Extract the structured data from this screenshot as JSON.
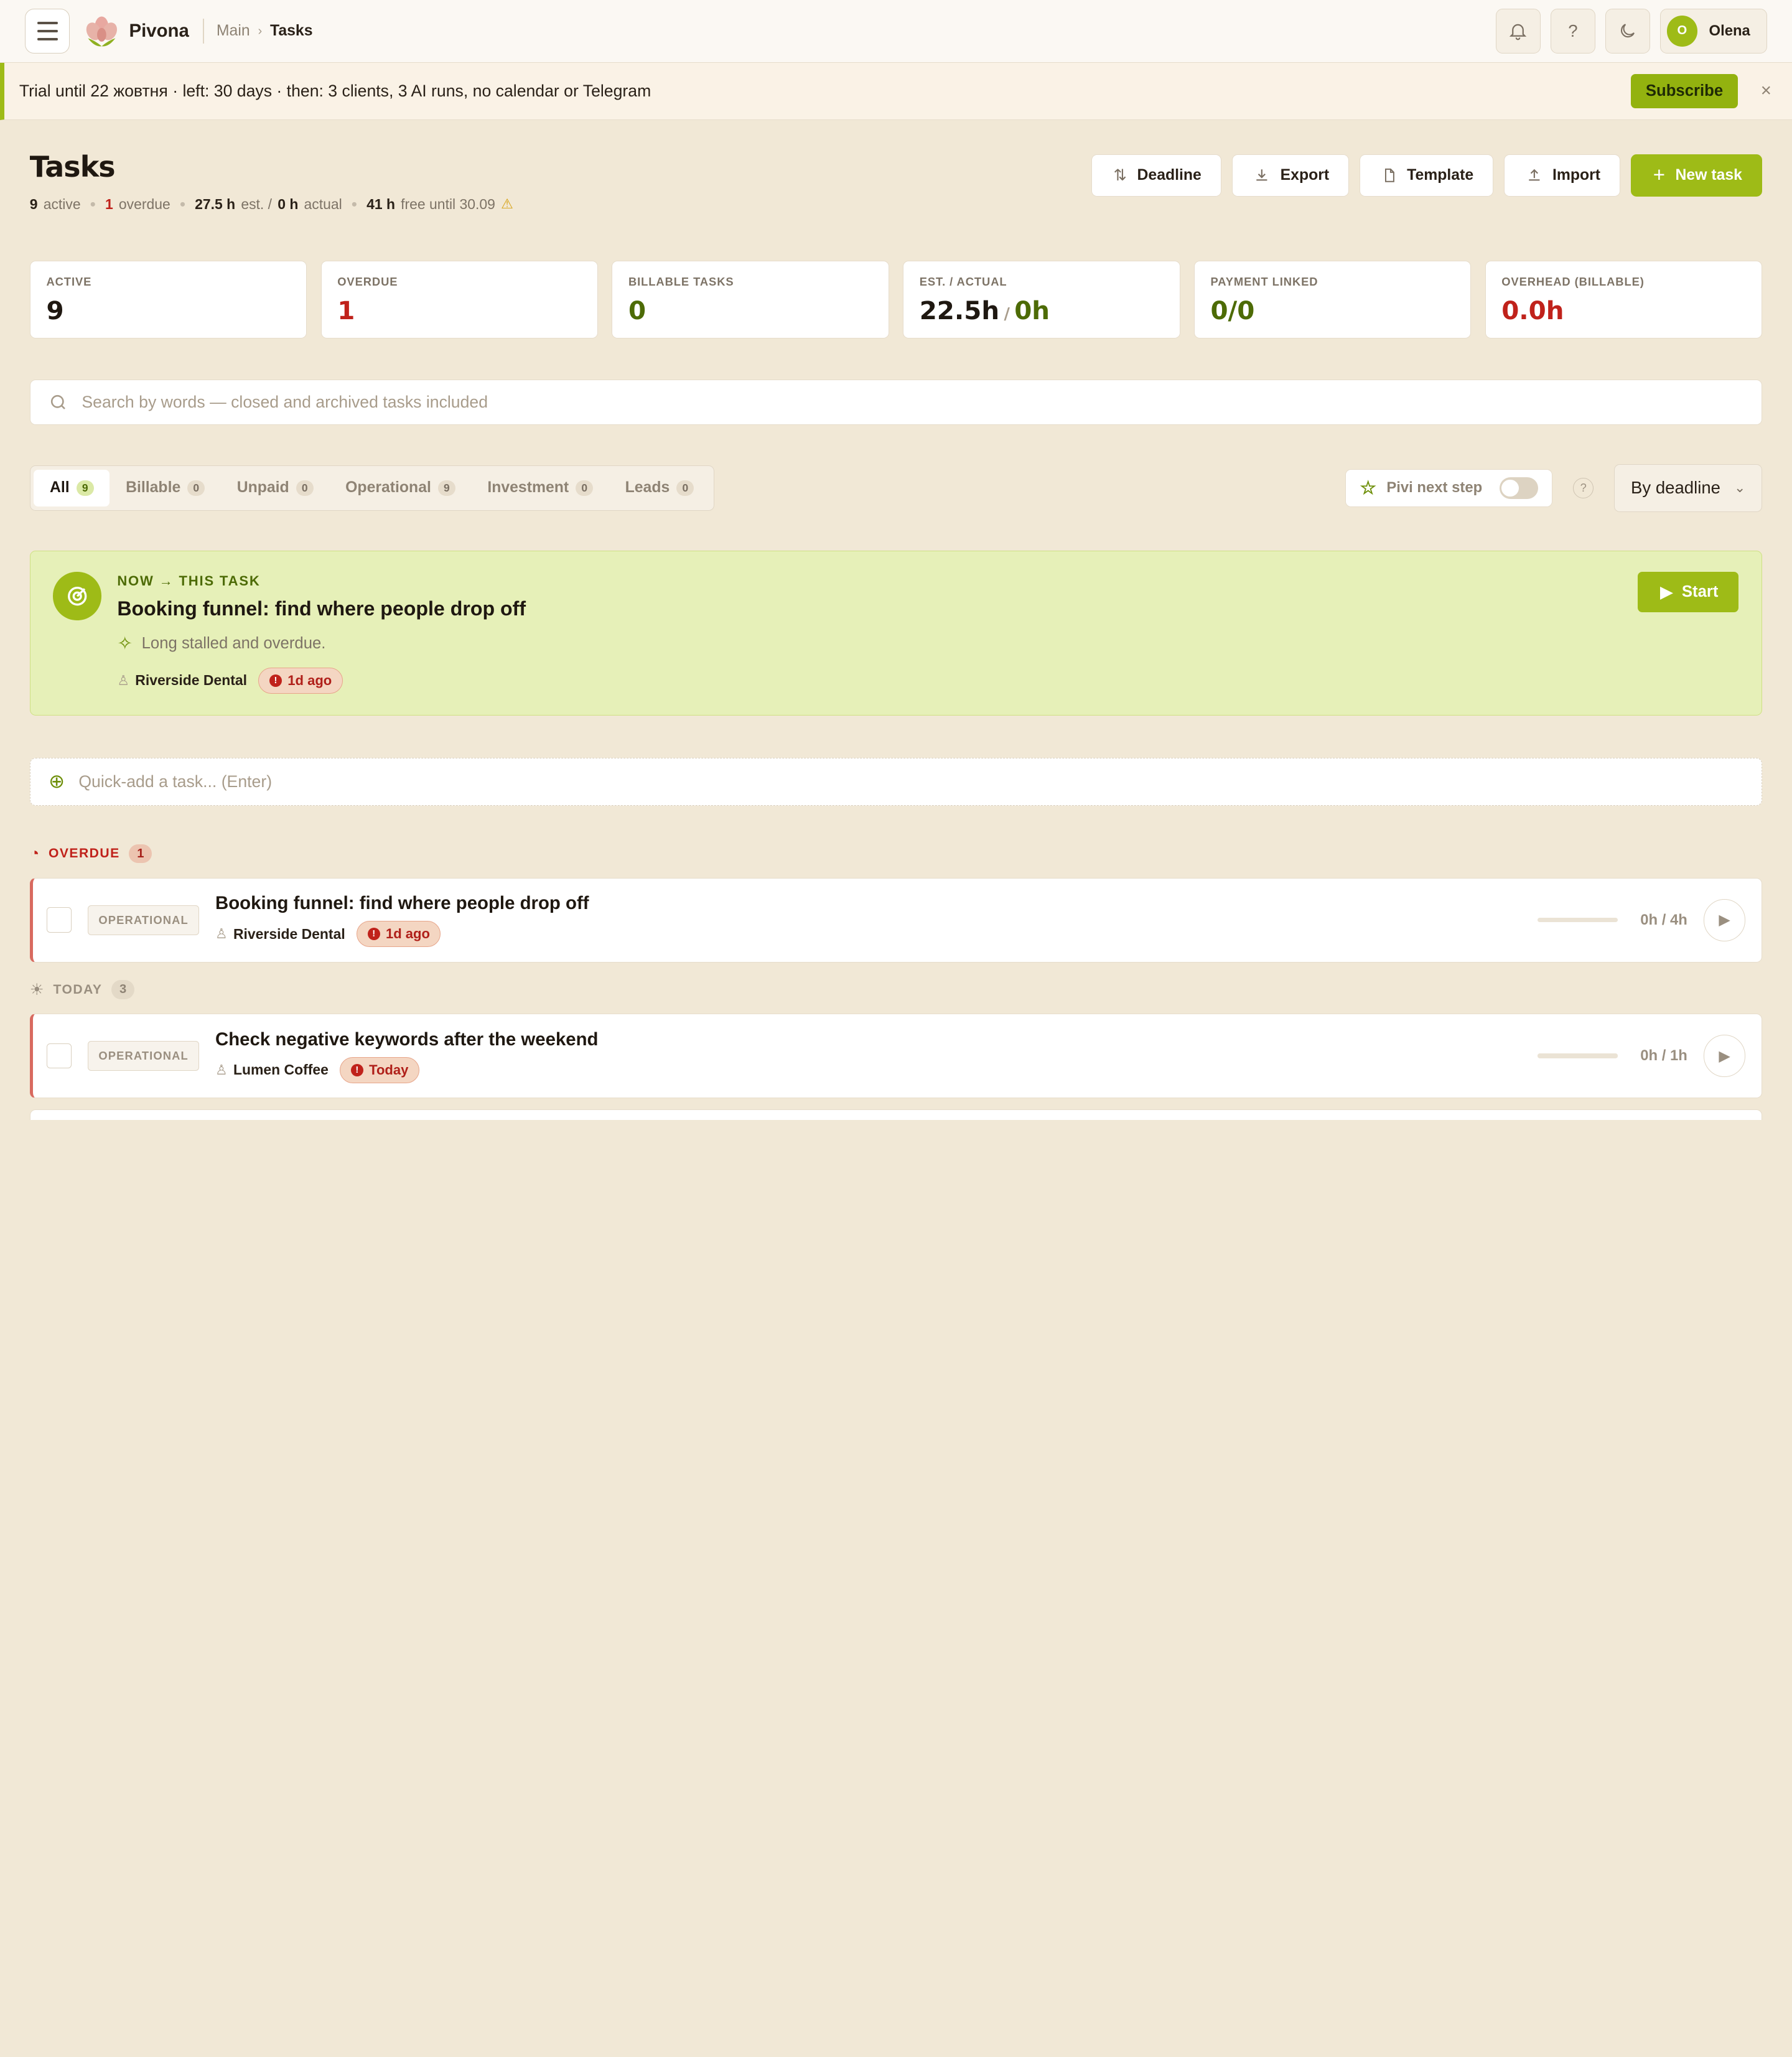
{
  "app": {
    "name": "Pivona"
  },
  "breadcrumb": {
    "parent": "Main",
    "current": "Tasks"
  },
  "topbar": {
    "help_label": "?",
    "user": {
      "initial": "O",
      "name": "Olena"
    }
  },
  "trial": {
    "text": "Trial until 22 жовтня · left: 30 days · then: 3 clients, 3 AI runs, no calendar or Telegram",
    "subscribe_label": "Subscribe",
    "close_label": "×"
  },
  "header": {
    "title": "Tasks",
    "stats": {
      "active_count": "9",
      "active_label": "active",
      "overdue_count": "1",
      "overdue_label": "overdue",
      "est_value": "27.5 h",
      "est_label": "est. /",
      "actual_value": "0 h",
      "actual_label": "actual",
      "free_value": "41 h",
      "free_label": "free until 30.09"
    },
    "actions": {
      "deadline": "Deadline",
      "export": "Export",
      "template": "Template",
      "import": "Import",
      "new_task": "New task"
    }
  },
  "kpis": [
    {
      "label": "ACTIVE",
      "value": "9"
    },
    {
      "label": "OVERDUE",
      "value": "1"
    },
    {
      "label": "BILLABLE TASKS",
      "value": "0"
    },
    {
      "label": "EST. / ACTUAL",
      "value": "22.5h",
      "value2": "0h"
    },
    {
      "label": "PAYMENT LINKED",
      "value": "0/0"
    },
    {
      "label": "OVERHEAD (BILLABLE)",
      "value": "0.0h"
    }
  ],
  "search": {
    "placeholder": "Search by words — closed and archived tasks included"
  },
  "tabs": [
    {
      "label": "All",
      "count": "9"
    },
    {
      "label": "Billable",
      "count": "0"
    },
    {
      "label": "Unpaid",
      "count": "0"
    },
    {
      "label": "Operational",
      "count": "9"
    },
    {
      "label": "Investment",
      "count": "0"
    },
    {
      "label": "Leads",
      "count": "0"
    }
  ],
  "pivi": {
    "label": "Pivi next step",
    "enabled": false
  },
  "sort": {
    "label": "By deadline"
  },
  "now": {
    "kicker": "NOW → THIS TASK",
    "title": "Booking funnel: find where people drop off",
    "reason": "Long stalled and overdue.",
    "client": "Riverside Dental",
    "due": "1d ago",
    "start_label": "Start"
  },
  "quick_add": {
    "placeholder": "Quick-add a task... (Enter)"
  },
  "groups": [
    {
      "label": "OVERDUE",
      "count": "1",
      "tasks": [
        {
          "type": "OPERATIONAL",
          "title": "Booking funnel: find where people drop off",
          "client": "Riverside Dental",
          "due": "1d ago",
          "hours": "0h / 4h",
          "progress": 0
        }
      ]
    },
    {
      "label": "TODAY",
      "count": "3",
      "tasks": [
        {
          "type": "OPERATIONAL",
          "title": "Check negative keywords after the weekend",
          "client": "Lumen Coffee",
          "due": "Today",
          "hours": "0h / 1h",
          "progress": 0
        }
      ]
    }
  ],
  "colors": {
    "accent": "#9ebb17",
    "danger": "#c0221b",
    "background": "#f1e8d6"
  }
}
